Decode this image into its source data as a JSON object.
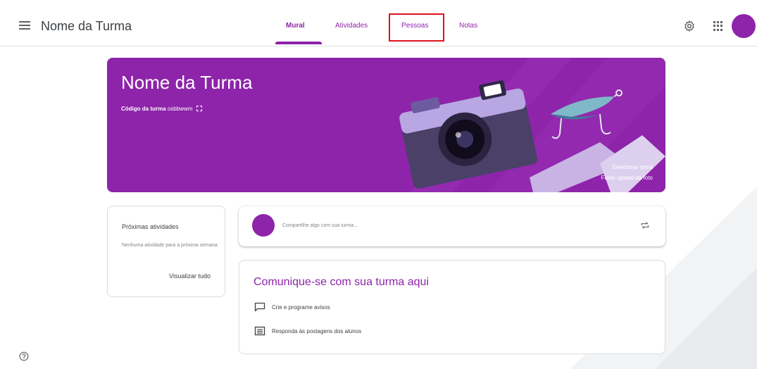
{
  "header": {
    "title": "Nome da Turma",
    "tabs": [
      {
        "label": "Mural",
        "active": true
      },
      {
        "label": "Atividades",
        "active": false
      },
      {
        "label": "Pessoas",
        "active": false
      },
      {
        "label": "Notas",
        "active": false
      }
    ],
    "icons": [
      "menu-icon",
      "gear-icon",
      "apps-icon",
      "avatar"
    ]
  },
  "banner": {
    "title": "Nome da Turma",
    "code_label": "Código da turma",
    "code_value": "osbbwwm",
    "select_theme": "Selecionar tema",
    "upload_photo": "Fazer upload da foto"
  },
  "upcoming": {
    "title": "Próximas atividades",
    "empty": "Nenhuma atividade para a próxima semana",
    "view_all": "Visualizar tudo"
  },
  "share": {
    "placeholder": "Compartilhe algo com sua turma..."
  },
  "communicate": {
    "title": "Comunique-se com sua turma aqui",
    "items": [
      {
        "icon": "announcement-icon",
        "label": "Crie e programe avisos"
      },
      {
        "icon": "chat-icon",
        "label": "Responda às postagens dos alunos"
      }
    ]
  },
  "colors": {
    "accent": "#8e24aa",
    "highlight": "#e0131e"
  }
}
